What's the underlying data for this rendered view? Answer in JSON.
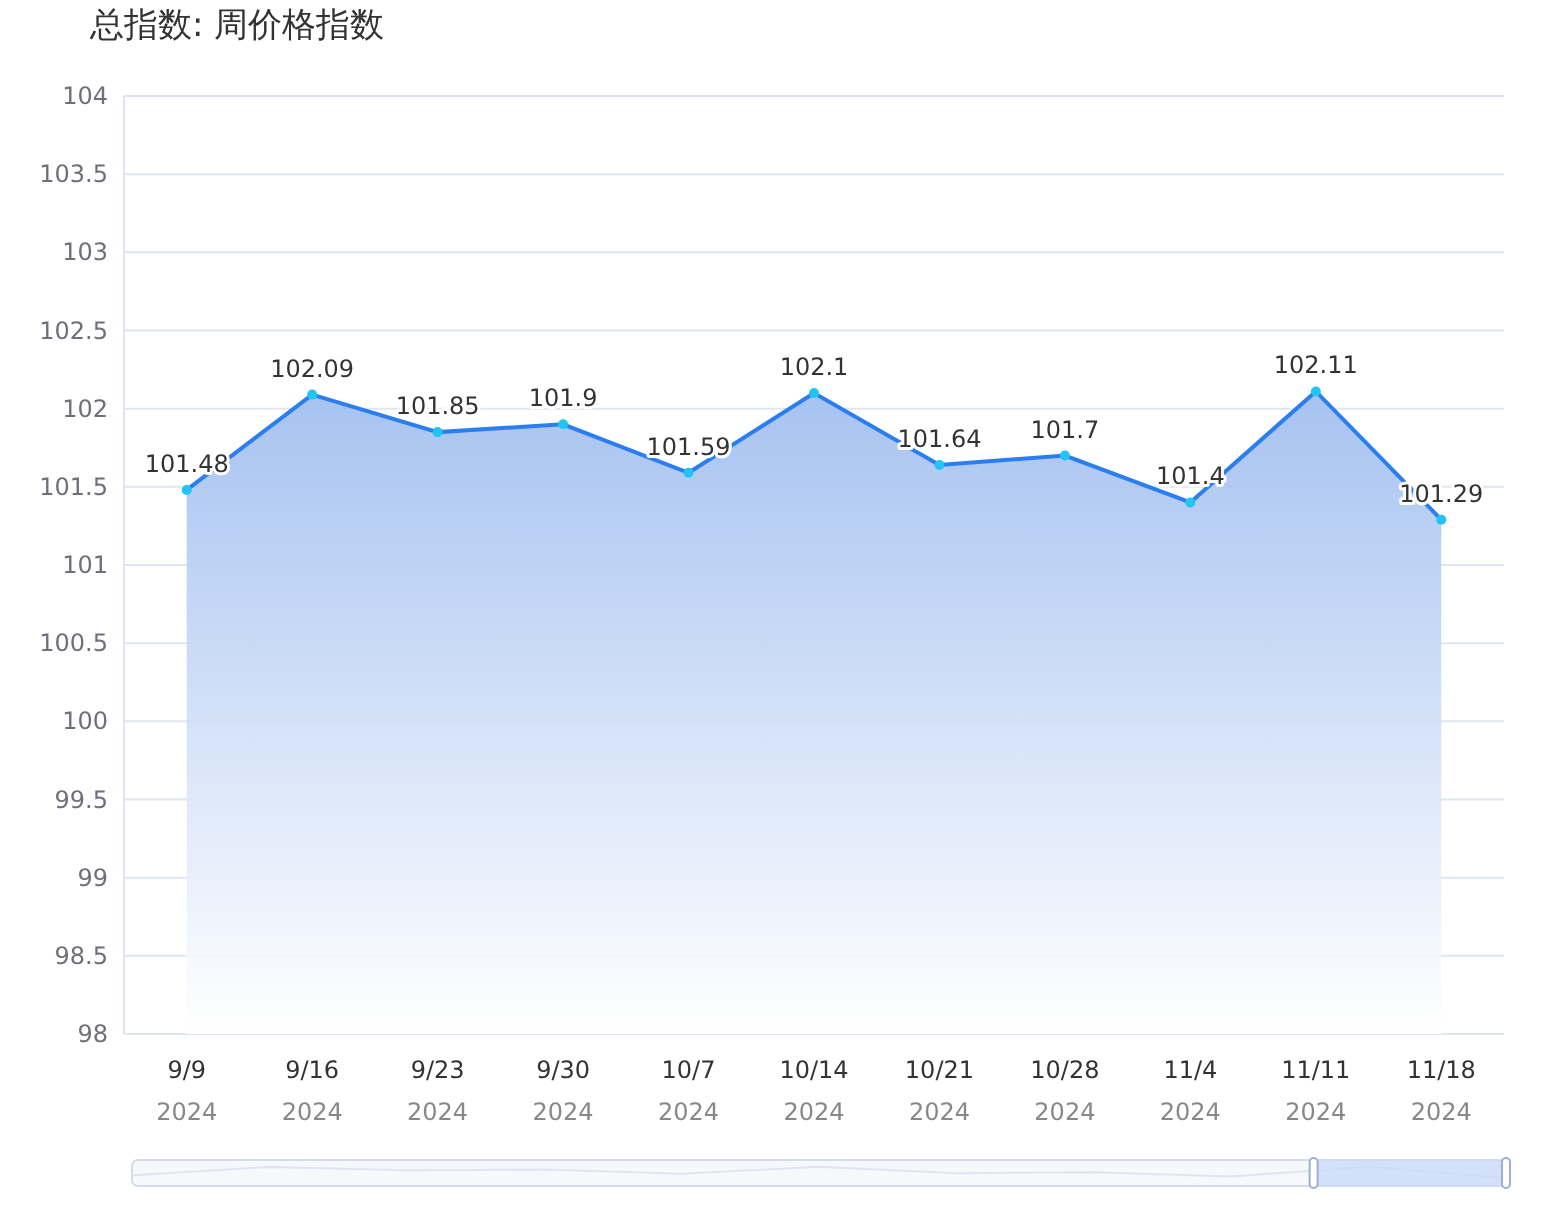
{
  "title": "总指数: 周价格指数",
  "chart_data": {
    "type": "area",
    "categories": [
      "9/9\n2024",
      "9/16\n2024",
      "9/23\n2024",
      "9/30\n2024",
      "10/7\n2024",
      "10/14\n2024",
      "10/21\n2024",
      "10/28\n2024",
      "11/4\n2024",
      "11/11\n2024",
      "11/18\n2024"
    ],
    "series": [
      {
        "color": "#2a7ef0",
        "values": [
          101.48,
          102.09,
          101.85,
          101.9,
          101.59,
          102.1,
          101.64,
          101.7,
          101.4,
          102.11,
          101.29
        ]
      }
    ],
    "ylim": [
      98,
      104
    ],
    "yticks": [
      98,
      98.5,
      99,
      99.5,
      100,
      100.5,
      101,
      101.5,
      102,
      102.5,
      103,
      103.5,
      104
    ],
    "data_labels": true,
    "grid": true
  },
  "zoom_slider": {
    "level": 0.14
  }
}
